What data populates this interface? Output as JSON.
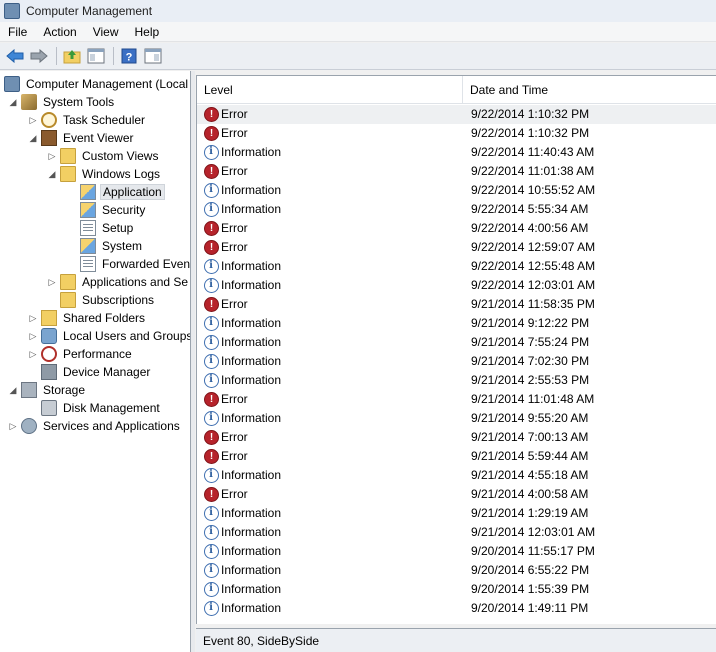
{
  "window": {
    "title": "Computer Management"
  },
  "menu": [
    "File",
    "Action",
    "View",
    "Help"
  ],
  "toolbar": {
    "icons": [
      "back-arrow-icon",
      "forward-arrow-icon",
      "up-folder-icon",
      "show-hide-tree-icon",
      "help-icon",
      "show-hide-action-pane-icon"
    ]
  },
  "tree": {
    "items": [
      {
        "label": "Computer Management (Local",
        "icon": "computer-icon",
        "arrow": ""
      },
      {
        "label": "System Tools",
        "icon": "tools-icon",
        "arrow": "expanded"
      },
      {
        "label": "Task Scheduler",
        "icon": "clock-icon",
        "arrow": "collapsed"
      },
      {
        "label": "Event Viewer",
        "icon": "event-viewer-icon",
        "arrow": "expanded"
      },
      {
        "label": "Custom Views",
        "icon": "folder-icon",
        "arrow": "collapsed"
      },
      {
        "label": "Windows Logs",
        "icon": "folder-icon",
        "arrow": "expanded"
      },
      {
        "label": "Application",
        "icon": "application-log-icon",
        "arrow": "",
        "selected": true
      },
      {
        "label": "Security",
        "icon": "security-log-icon",
        "arrow": ""
      },
      {
        "label": "Setup",
        "icon": "setup-log-icon",
        "arrow": ""
      },
      {
        "label": "System",
        "icon": "system-log-icon",
        "arrow": ""
      },
      {
        "label": "Forwarded Event",
        "icon": "forwarded-log-icon",
        "arrow": ""
      },
      {
        "label": "Applications and Se",
        "icon": "folder-icon",
        "arrow": "collapsed"
      },
      {
        "label": "Subscriptions",
        "icon": "subscriptions-icon",
        "arrow": ""
      },
      {
        "label": "Shared Folders",
        "icon": "shared-folders-icon",
        "arrow": "collapsed"
      },
      {
        "label": "Local Users and Groups",
        "icon": "users-icon",
        "arrow": "collapsed"
      },
      {
        "label": "Performance",
        "icon": "performance-icon",
        "arrow": "collapsed"
      },
      {
        "label": "Device Manager",
        "icon": "device-manager-icon",
        "arrow": ""
      },
      {
        "label": "Storage",
        "icon": "storage-icon",
        "arrow": "expanded"
      },
      {
        "label": "Disk Management",
        "icon": "disk-icon",
        "arrow": ""
      },
      {
        "label": "Services and Applications",
        "icon": "services-icon",
        "arrow": "collapsed"
      }
    ]
  },
  "list": {
    "columns": [
      "Level",
      "Date and Time"
    ],
    "rows": [
      {
        "level": "Error",
        "date": "9/22/2014 1:10:32 PM"
      },
      {
        "level": "Error",
        "date": "9/22/2014 1:10:32 PM"
      },
      {
        "level": "Information",
        "date": "9/22/2014 11:40:43 AM"
      },
      {
        "level": "Error",
        "date": "9/22/2014 11:01:38 AM"
      },
      {
        "level": "Information",
        "date": "9/22/2014 10:55:52 AM"
      },
      {
        "level": "Information",
        "date": "9/22/2014 5:55:34 AM"
      },
      {
        "level": "Error",
        "date": "9/22/2014 4:00:56 AM"
      },
      {
        "level": "Error",
        "date": "9/22/2014 12:59:07 AM"
      },
      {
        "level": "Information",
        "date": "9/22/2014 12:55:48 AM"
      },
      {
        "level": "Information",
        "date": "9/22/2014 12:03:01 AM"
      },
      {
        "level": "Error",
        "date": "9/21/2014 11:58:35 PM"
      },
      {
        "level": "Information",
        "date": "9/21/2014 9:12:22 PM"
      },
      {
        "level": "Information",
        "date": "9/21/2014 7:55:24 PM"
      },
      {
        "level": "Information",
        "date": "9/21/2014 7:02:30 PM"
      },
      {
        "level": "Information",
        "date": "9/21/2014 2:55:53 PM"
      },
      {
        "level": "Error",
        "date": "9/21/2014 11:01:48 AM"
      },
      {
        "level": "Information",
        "date": "9/21/2014 9:55:20 AM"
      },
      {
        "level": "Error",
        "date": "9/21/2014 7:00:13 AM"
      },
      {
        "level": "Error",
        "date": "9/21/2014 5:59:44 AM"
      },
      {
        "level": "Information",
        "date": "9/21/2014 4:55:18 AM"
      },
      {
        "level": "Error",
        "date": "9/21/2014 4:00:58 AM"
      },
      {
        "level": "Information",
        "date": "9/21/2014 1:29:19 AM"
      },
      {
        "level": "Information",
        "date": "9/21/2014 12:03:01 AM"
      },
      {
        "level": "Information",
        "date": "9/20/2014 11:55:17 PM"
      },
      {
        "level": "Information",
        "date": "9/20/2014 6:55:22 PM"
      },
      {
        "level": "Information",
        "date": "9/20/2014 1:55:39 PM"
      },
      {
        "level": "Information",
        "date": "9/20/2014 1:49:11 PM"
      }
    ]
  },
  "status": {
    "text": "Event 80, SideBySide"
  }
}
